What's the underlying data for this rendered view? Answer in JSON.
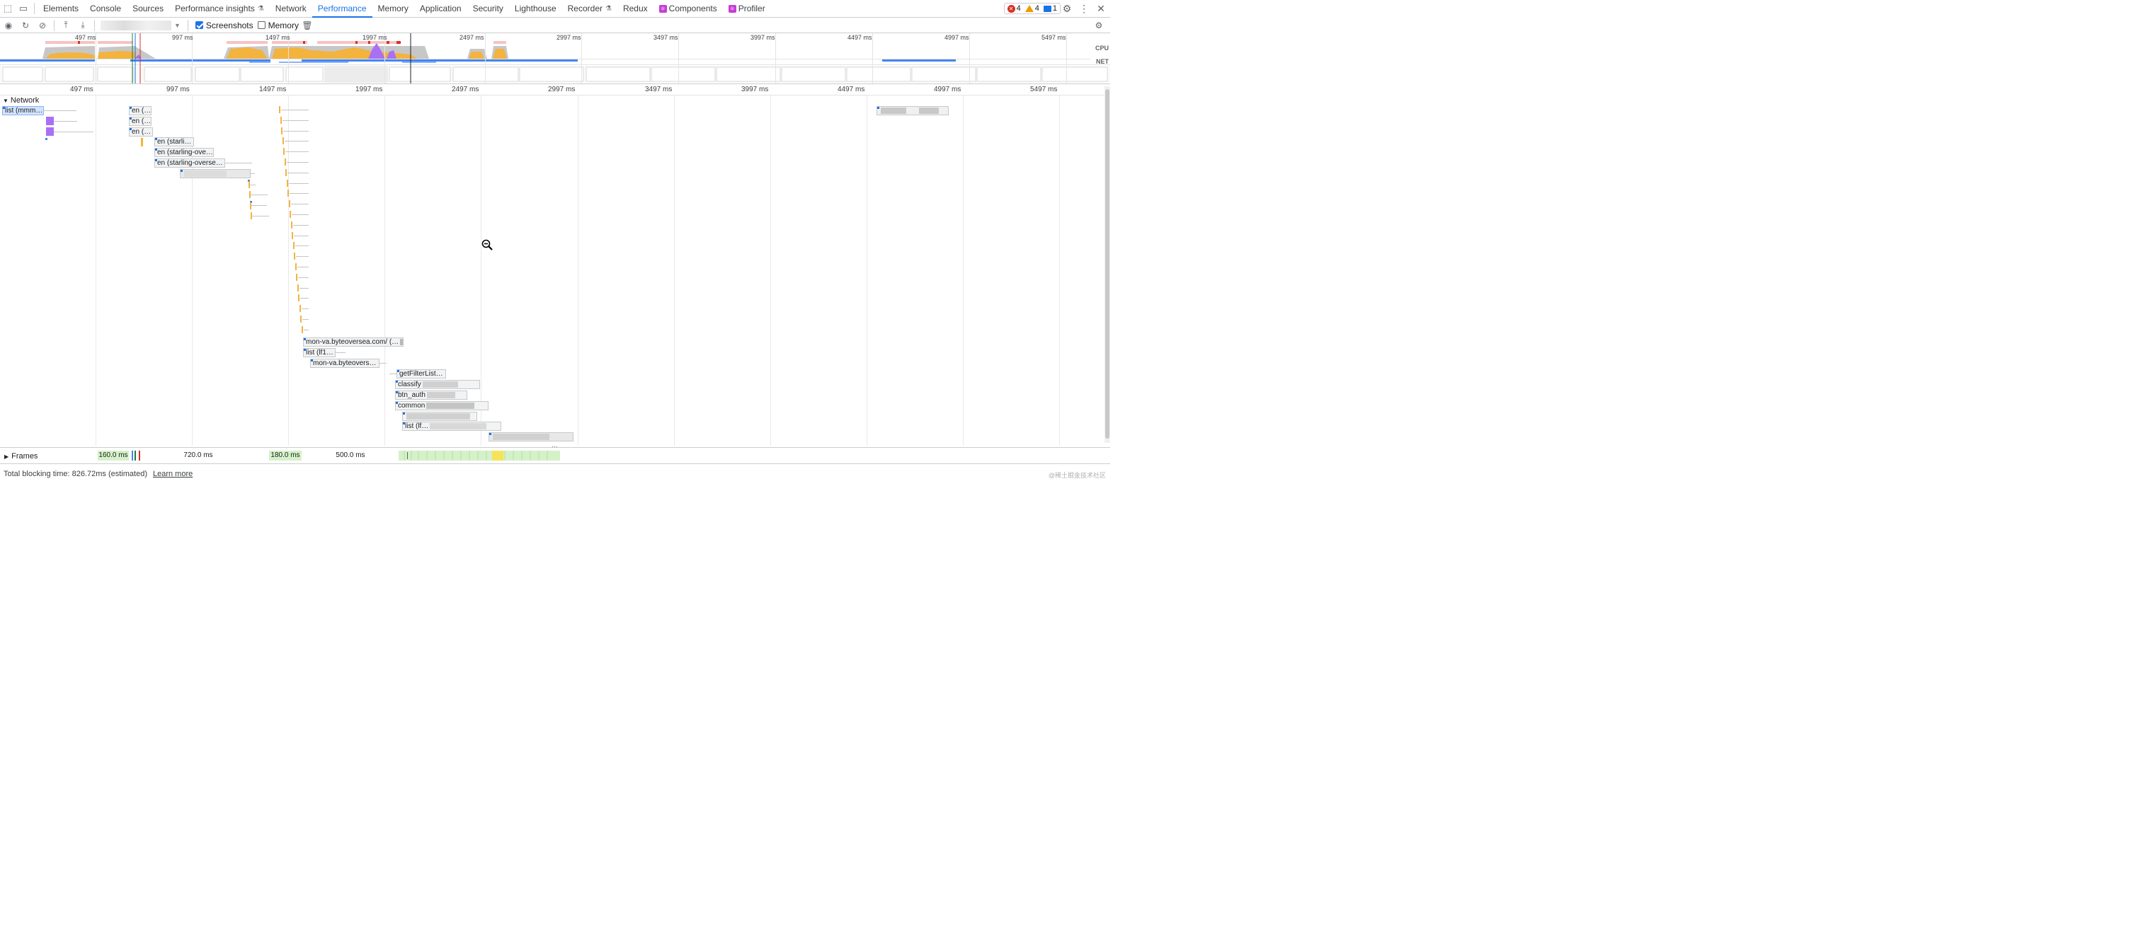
{
  "tabs": [
    {
      "label": "Elements"
    },
    {
      "label": "Console"
    },
    {
      "label": "Sources"
    },
    {
      "label": "Performance insights",
      "flask": true
    },
    {
      "label": "Network"
    },
    {
      "label": "Performance",
      "active": true
    },
    {
      "label": "Memory"
    },
    {
      "label": "Application"
    },
    {
      "label": "Security"
    },
    {
      "label": "Lighthouse"
    },
    {
      "label": "Recorder",
      "flask": true
    },
    {
      "label": "Redux"
    },
    {
      "label": "Components",
      "react": true
    },
    {
      "label": "Profiler",
      "react": true
    }
  ],
  "counters": {
    "errors": "4",
    "warnings": "4",
    "messages": "1"
  },
  "toolbar": {
    "screenshots_label": "Screenshots",
    "memory_label": "Memory",
    "screenshots_checked": true,
    "memory_checked": false
  },
  "overview": {
    "ticks": [
      "497 ms",
      "997 ms",
      "1497 ms",
      "1997 ms",
      "2497 ms",
      "2997 ms",
      "3497 ms",
      "3997 ms",
      "4497 ms",
      "4997 ms",
      "5497 ms"
    ],
    "cpu_label": "CPU",
    "net_label": "NET"
  },
  "ruler": {
    "ticks": [
      "497 ms",
      "997 ms",
      "1497 ms",
      "1997 ms",
      "2497 ms",
      "2997 ms",
      "3497 ms",
      "3997 ms",
      "4497 ms",
      "4997 ms",
      "5497 ms"
    ]
  },
  "network": {
    "title": "Network",
    "requests": [
      {
        "label": "list (mmm…",
        "selected": true
      },
      {
        "label": "en (…"
      },
      {
        "label": "en (…"
      },
      {
        "label": "en (…"
      },
      {
        "label": "en (starli…"
      },
      {
        "label": "en (starling-ove…"
      },
      {
        "label": "en (starling-overse…"
      },
      {
        "label": "mon-va.byteoversea.com/ (…"
      },
      {
        "label": "list (lf1…"
      },
      {
        "label": "mon-va.byteovers…"
      },
      {
        "label": "getFilterList…"
      },
      {
        "label": "classify"
      },
      {
        "label": "btn_auth"
      },
      {
        "label": "common"
      },
      {
        "label": "list (lf…"
      }
    ]
  },
  "frames": {
    "title": "Frames",
    "blocks": [
      "160.0 ms",
      "720.0 ms",
      "180.0 ms",
      "500.0 ms"
    ]
  },
  "footer": {
    "tbt": "Total blocking time: 826.72ms (estimated)",
    "learn_more": "Learn more"
  },
  "watermark": "@稀土掘金技术社区",
  "colors": {
    "accent": "#1a73e8",
    "scripting": "#f3b33d",
    "rendering": "#a970f4",
    "loading": "#4285f4"
  }
}
